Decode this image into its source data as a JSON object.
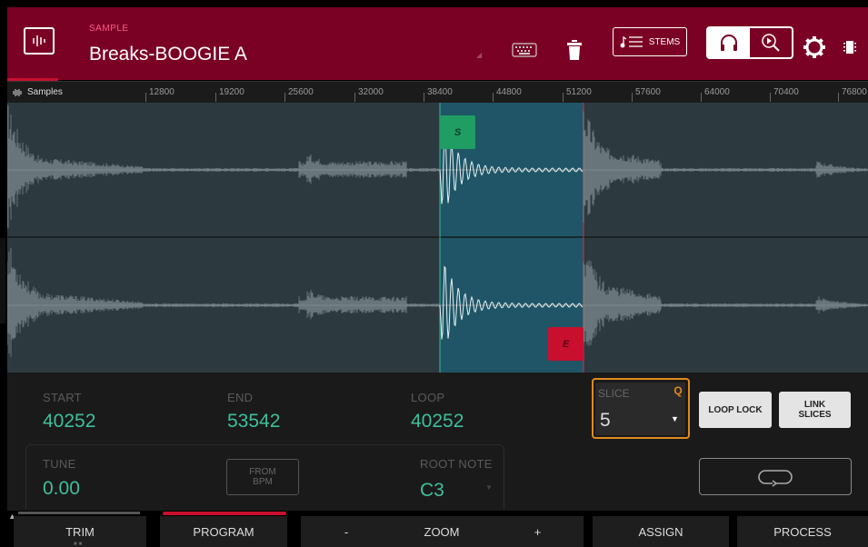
{
  "header": {
    "sample_label": "SAMPLE",
    "sample_name": "Breaks-BOOGIE A",
    "stems_label": "STEMS",
    "accent_color": "#7a0024"
  },
  "ruler": {
    "unit_label": "Samples",
    "ticks": [
      "12800",
      "19200",
      "25600",
      "32000",
      "38400",
      "44800",
      "51200",
      "57600",
      "64000",
      "70400",
      "76800"
    ]
  },
  "markers": {
    "start": "S",
    "end": "E"
  },
  "params": {
    "start": {
      "label": "START",
      "value": "40252"
    },
    "end": {
      "label": "END",
      "value": "53542"
    },
    "loop": {
      "label": "LOOP",
      "value": "40252"
    },
    "tune": {
      "label": "TUNE",
      "value": "0.00"
    },
    "from_bpm": "FROM\nBPM",
    "root_note": {
      "label": "ROOT NOTE",
      "value": "C3"
    },
    "slice": {
      "label": "SLICE",
      "value": "5",
      "q": "Q"
    },
    "loop_lock": "LOOP LOCK",
    "link_slices": "LINK\nSLICES"
  },
  "bottom": {
    "trim": "TRIM",
    "program": "PROGRAM",
    "zoom_minus": "-",
    "zoom": "ZOOM",
    "zoom_plus": "+",
    "assign": "ASSIGN",
    "process": "PROCESS"
  },
  "icons": {
    "app": "waveform-icon",
    "keyboard": "keyboard-icon",
    "trash": "trash-icon",
    "headphones": "headphones-icon",
    "zoom": "zoom-play-icon",
    "gear": "gear-icon",
    "chip": "chip-icon",
    "loop": "loop-icon"
  }
}
